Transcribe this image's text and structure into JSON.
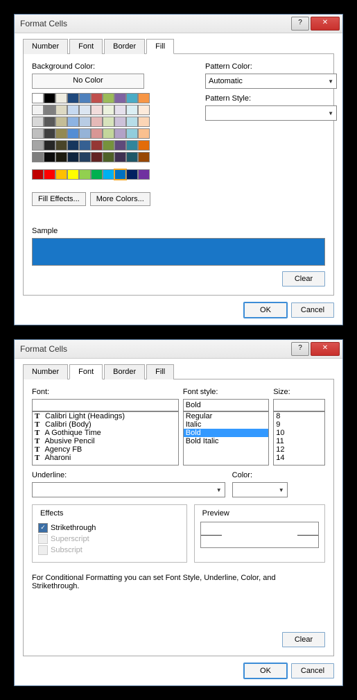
{
  "dialog_title": "Format Cells",
  "titlebar": {
    "help": "?",
    "close": "✕"
  },
  "tabs": {
    "number": "Number",
    "font": "Font",
    "border": "Border",
    "fill": "Fill"
  },
  "fill": {
    "bg_label": "Background Color:",
    "no_color": "No Color",
    "fill_effects": "Fill Effects...",
    "more_colors": "More Colors...",
    "pattern_color_label": "Pattern Color:",
    "pattern_color_value": "Automatic",
    "pattern_style_label": "Pattern Style:",
    "sample_label": "Sample",
    "sample_color": "#1976c7",
    "theme_colors": [
      [
        "#ffffff",
        "#000000",
        "#eeece1",
        "#1f497d",
        "#4f81bd",
        "#c0504d",
        "#9bbb59",
        "#8064a2",
        "#4bacc6",
        "#f79646"
      ],
      [
        "#f2f2f2",
        "#7f7f7f",
        "#ddd9c3",
        "#c6d9f0",
        "#dbe5f1",
        "#f2dcdb",
        "#ebf1dd",
        "#e5e0ec",
        "#dbeef3",
        "#fdeada"
      ],
      [
        "#d8d8d8",
        "#595959",
        "#c4bd97",
        "#8db3e2",
        "#b8cce4",
        "#e5b9b7",
        "#d7e3bc",
        "#ccc1d9",
        "#b7dde8",
        "#fbd5b5"
      ],
      [
        "#bfbfbf",
        "#3f3f3f",
        "#938953",
        "#548dd4",
        "#95b3d7",
        "#d99694",
        "#c3d69b",
        "#b2a2c7",
        "#92cddc",
        "#fac08f"
      ],
      [
        "#a5a5a5",
        "#262626",
        "#494429",
        "#17365d",
        "#366092",
        "#953734",
        "#76923c",
        "#5f497a",
        "#31859b",
        "#e36c09"
      ],
      [
        "#7f7f7f",
        "#0c0c0c",
        "#1d1b10",
        "#0f243e",
        "#244061",
        "#632423",
        "#4f6128",
        "#3f3151",
        "#205867",
        "#974806"
      ]
    ],
    "standard_colors": [
      "#c00000",
      "#ff0000",
      "#ffc000",
      "#ffff00",
      "#92d050",
      "#00b050",
      "#00b0f0",
      "#0070c0",
      "#002060",
      "#7030a0"
    ],
    "selected_swatch": "#0070c0"
  },
  "font": {
    "font_label": "Font:",
    "font_value": "",
    "font_list": [
      "Calibri Light (Headings)",
      "Calibri (Body)",
      "A Gothique Time",
      "Abusive Pencil",
      "Agency FB",
      "Aharoni"
    ],
    "style_label": "Font style:",
    "style_value": "Bold",
    "style_list": [
      "Regular",
      "Italic",
      "Bold",
      "Bold Italic"
    ],
    "style_selected": "Bold",
    "size_label": "Size:",
    "size_value": "",
    "size_list": [
      "8",
      "9",
      "10",
      "11",
      "12",
      "14"
    ],
    "underline_label": "Underline:",
    "color_label": "Color:",
    "effects_label": "Effects",
    "fx_strike": "Strikethrough",
    "fx_super": "Superscript",
    "fx_sub": "Subscript",
    "preview_label": "Preview",
    "note": "For Conditional Formatting you can set Font Style, Underline, Color, and Strikethrough."
  },
  "buttons": {
    "clear": "Clear",
    "ok": "OK",
    "cancel": "Cancel"
  }
}
